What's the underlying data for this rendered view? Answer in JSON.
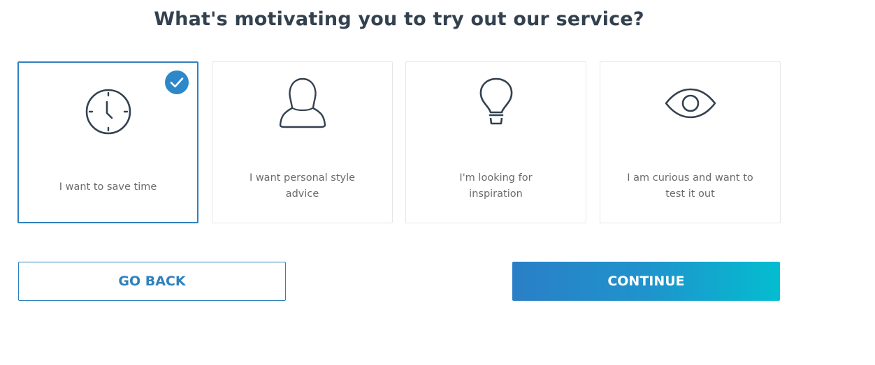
{
  "page": {
    "title": "What's motivating you to try out our service?"
  },
  "options": [
    {
      "label_line1": "I want to save time",
      "label_line2": "",
      "icon": "clock-icon",
      "selected": true
    },
    {
      "label_line1": "I want personal style",
      "label_line2": "advice",
      "icon": "person-icon",
      "selected": false
    },
    {
      "label_line1": "I'm looking for",
      "label_line2": "inspiration",
      "icon": "lightbulb-icon",
      "selected": false
    },
    {
      "label_line1": "I am curious and want to",
      "label_line2": "test it out",
      "icon": "eye-icon",
      "selected": false
    }
  ],
  "buttons": {
    "back_label": "GO BACK",
    "continue_label": "CONTINUE"
  },
  "colors": {
    "accent": "#2f81bd",
    "title": "#33414f",
    "label": "#6b6b6b",
    "gradient_start": "#2a7fc6",
    "gradient_end": "#04bdd0"
  }
}
